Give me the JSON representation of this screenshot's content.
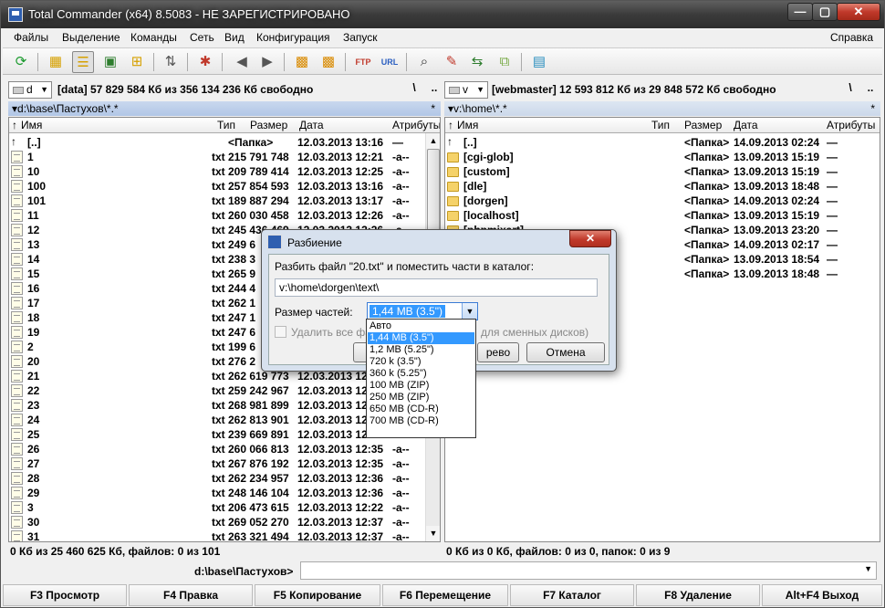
{
  "window": {
    "title": "Total Commander (x64) 8.5083 - НЕ ЗАРЕГИСТРИРОВАНО"
  },
  "menu": {
    "items": [
      "Файлы",
      "Выделение",
      "Команды",
      "Сеть",
      "Вид",
      "Конфигурация",
      "Запуск"
    ],
    "help": "Справка"
  },
  "left": {
    "drive": "d",
    "drive_info": "[data]  57 829 584 Кб из 356 134 236 Кб свободно",
    "nav_root": "\\",
    "nav_up": "..",
    "path": "d:\\base\\Пастухов\\*.*",
    "path_star": "*",
    "columns": {
      "name": "Имя",
      "type": "Тип",
      "size": "Размер",
      "date": "Дата",
      "attr": "Атрибуты"
    },
    "rows": [
      {
        "name": "[..]",
        "type": "",
        "size": "<Папка>",
        "date": "12.03.2013 13:16",
        "attr": "—",
        "icon": "up"
      },
      {
        "name": "1",
        "type": "txt",
        "size": "215 791 748",
        "date": "12.03.2013 12:21",
        "attr": "-a--",
        "icon": "txt"
      },
      {
        "name": "10",
        "type": "txt",
        "size": "209 789 414",
        "date": "12.03.2013 12:25",
        "attr": "-a--",
        "icon": "txt"
      },
      {
        "name": "100",
        "type": "txt",
        "size": "257 854 593",
        "date": "12.03.2013 13:16",
        "attr": "-a--",
        "icon": "txt"
      },
      {
        "name": "101",
        "type": "txt",
        "size": "189 887 294",
        "date": "12.03.2013 13:17",
        "attr": "-a--",
        "icon": "txt"
      },
      {
        "name": "11",
        "type": "txt",
        "size": "260 030 458",
        "date": "12.03.2013 12:26",
        "attr": "-a--",
        "icon": "txt"
      },
      {
        "name": "12",
        "type": "txt",
        "size": "245 436 469",
        "date": "12.03.2013 12:26",
        "attr": "-a--",
        "icon": "txt"
      },
      {
        "name": "13",
        "type": "txt",
        "size": "249 6",
        "date": "",
        "attr": "",
        "icon": "txt"
      },
      {
        "name": "14",
        "type": "txt",
        "size": "238 3",
        "date": "",
        "attr": "",
        "icon": "txt"
      },
      {
        "name": "15",
        "type": "txt",
        "size": "265 9",
        "date": "",
        "attr": "",
        "icon": "txt"
      },
      {
        "name": "16",
        "type": "txt",
        "size": "244 4",
        "date": "",
        "attr": "",
        "icon": "txt"
      },
      {
        "name": "17",
        "type": "txt",
        "size": "262 1",
        "date": "",
        "attr": "",
        "icon": "txt"
      },
      {
        "name": "18",
        "type": "txt",
        "size": "247 1",
        "date": "",
        "attr": "",
        "icon": "txt"
      },
      {
        "name": "19",
        "type": "txt",
        "size": "247 6",
        "date": "",
        "attr": "",
        "icon": "txt"
      },
      {
        "name": "2",
        "type": "txt",
        "size": "199 6",
        "date": "",
        "attr": "",
        "icon": "txt"
      },
      {
        "name": "20",
        "type": "txt",
        "size": "276 2",
        "date": "",
        "attr": "",
        "icon": "txt"
      },
      {
        "name": "21",
        "type": "txt",
        "size": "262 619 773",
        "date": "12.03.2013 12:31",
        "attr": "-a--",
        "icon": "txt"
      },
      {
        "name": "22",
        "type": "txt",
        "size": "259 242 967",
        "date": "12.03.2013 12:31",
        "attr": "-a--",
        "icon": "txt"
      },
      {
        "name": "23",
        "type": "txt",
        "size": "268 981 899",
        "date": "12.03.2013 12:31",
        "attr": "-a--",
        "icon": "txt"
      },
      {
        "name": "24",
        "type": "txt",
        "size": "262 813 901",
        "date": "12.03.2013 12:33",
        "attr": "-a--",
        "icon": "txt"
      },
      {
        "name": "25",
        "type": "txt",
        "size": "239 669 891",
        "date": "12.03.2013 12:33",
        "attr": "-a--",
        "icon": "txt"
      },
      {
        "name": "26",
        "type": "txt",
        "size": "260 066 813",
        "date": "12.03.2013 12:35",
        "attr": "-a--",
        "icon": "txt"
      },
      {
        "name": "27",
        "type": "txt",
        "size": "267 876 192",
        "date": "12.03.2013 12:35",
        "attr": "-a--",
        "icon": "txt"
      },
      {
        "name": "28",
        "type": "txt",
        "size": "262 234 957",
        "date": "12.03.2013 12:36",
        "attr": "-a--",
        "icon": "txt"
      },
      {
        "name": "29",
        "type": "txt",
        "size": "248 146 104",
        "date": "12.03.2013 12:36",
        "attr": "-a--",
        "icon": "txt"
      },
      {
        "name": "3",
        "type": "txt",
        "size": "206 473 615",
        "date": "12.03.2013 12:22",
        "attr": "-a--",
        "icon": "txt"
      },
      {
        "name": "30",
        "type": "txt",
        "size": "269 052 270",
        "date": "12.03.2013 12:37",
        "attr": "-a--",
        "icon": "txt"
      },
      {
        "name": "31",
        "type": "txt",
        "size": "263 321 494",
        "date": "12.03.2013 12:37",
        "attr": "-a--",
        "icon": "txt"
      }
    ],
    "status": "0 Кб из 25 460 625 Кб, файлов: 0 из 101"
  },
  "right": {
    "drive": "v",
    "drive_info": "[webmaster]  12 593 812 Кб из 29 848 572 Кб свободно",
    "nav_root": "\\",
    "nav_up": "..",
    "path": "v:\\home\\*.*",
    "path_star": "*",
    "columns": {
      "name": "Имя",
      "type": "Тип",
      "size": "Размер",
      "date": "Дата",
      "attr": "Атрибуты"
    },
    "rows": [
      {
        "name": "[..]",
        "size": "<Папка>",
        "date": "14.09.2013 02:24",
        "attr": "—",
        "icon": "up"
      },
      {
        "name": "[cgi-glob]",
        "size": "<Папка>",
        "date": "13.09.2013 15:19",
        "attr": "—",
        "icon": "folder"
      },
      {
        "name": "[custom]",
        "size": "<Папка>",
        "date": "13.09.2013 15:19",
        "attr": "—",
        "icon": "folder"
      },
      {
        "name": "[dle]",
        "size": "<Папка>",
        "date": "13.09.2013 18:48",
        "attr": "—",
        "icon": "folder"
      },
      {
        "name": "[dorgen]",
        "size": "<Папка>",
        "date": "14.09.2013 02:24",
        "attr": "—",
        "icon": "folder"
      },
      {
        "name": "[localhost]",
        "size": "<Папка>",
        "date": "13.09.2013 15:19",
        "attr": "—",
        "icon": "folder"
      },
      {
        "name": "[phpmixart]",
        "size": "<Папка>",
        "date": "13.09.2013 23:20",
        "attr": "—",
        "icon": "folder"
      },
      {
        "name": "",
        "size": "<Папка>",
        "date": "14.09.2013 02:17",
        "attr": "—",
        "icon": ""
      },
      {
        "name": "",
        "size": "<Папка>",
        "date": "13.09.2013 18:54",
        "attr": "—",
        "icon": ""
      },
      {
        "name": "",
        "size": "<Папка>",
        "date": "13.09.2013 18:48",
        "attr": "—",
        "icon": ""
      }
    ],
    "status": "0 Кб из 0 Кб, файлов: 0 из 0, папок: 0 из 9"
  },
  "command": {
    "label": "d:\\base\\Пастухов>",
    "value": ""
  },
  "fkeys": [
    "F3 Просмотр",
    "F4 Правка",
    "F5 Копирование",
    "F6 Перемещение",
    "F7 Каталог",
    "F8 Удаление",
    "Alt+F4 Выход"
  ],
  "dialog": {
    "title": "Разбиение",
    "close": "✕",
    "prompt": "Разбить файл \"20.txt\" и поместить части в каталог:",
    "target_dir": "v:\\home\\dorgen\\text\\",
    "part_size_label": "Размер частей:",
    "part_size_value": "1,44 MB (3.5\")",
    "delete_label": "Удалить все фай",
    "removable_hint": "для сменных дисков)",
    "ok_label": "",
    "tree_label": "рево",
    "cancel_label": "Отмена",
    "options": [
      "Авто",
      "1,44 MB (3.5\")",
      "1,2 MB (5.25\")",
      "720 k (3.5\")",
      "360 k (5.25\")",
      "100 MB (ZIP)",
      "250 MB (ZIP)",
      "650 MB (CD-R)",
      "700 MB (CD-R)"
    ],
    "selected_index": 1
  },
  "scroll": {
    "left_fraction_start": 0.0,
    "left_fraction_visible": 0.26
  }
}
